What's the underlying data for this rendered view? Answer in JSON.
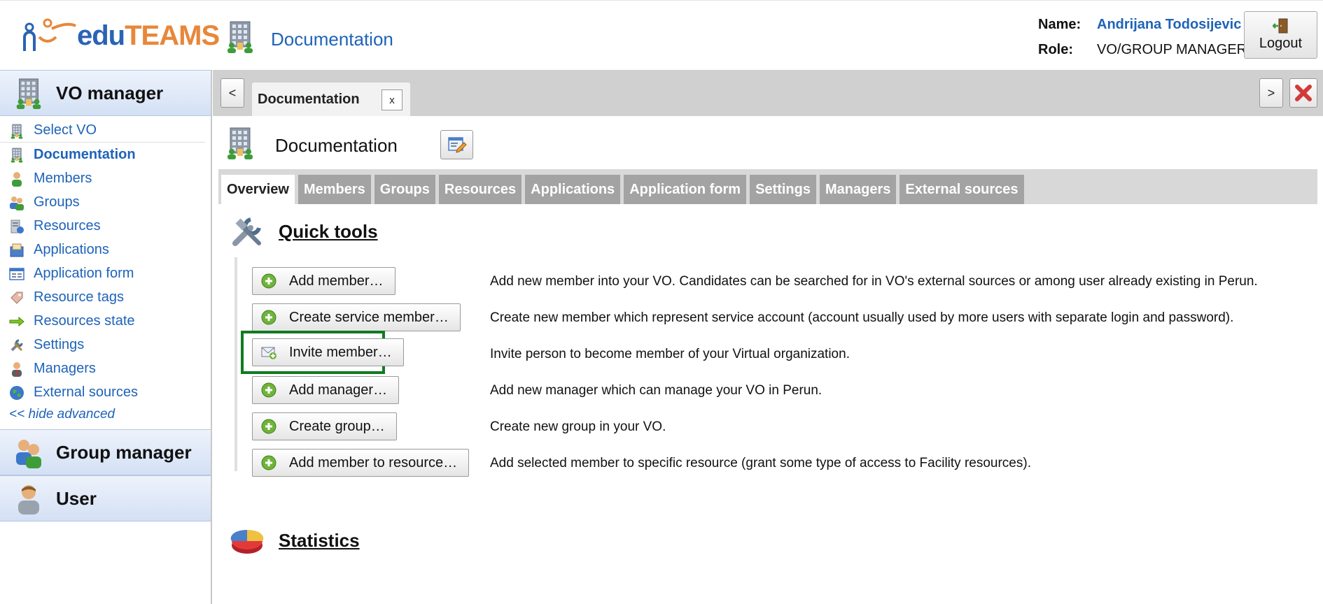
{
  "header": {
    "logo": {
      "part1": "edu",
      "part2": "TEAMS"
    },
    "section_title": "Documentation",
    "name_label": "Name:",
    "user_name": "Andrijana Todosijevic",
    "role_label": "Role:",
    "role_value": "VO/GROUP MANAGER",
    "logout_label": "Logout"
  },
  "sidebar": {
    "vo_manager_label": "VO manager",
    "items": [
      {
        "label": "Select VO",
        "icon": "building-icon"
      },
      {
        "label": "Documentation",
        "icon": "building-icon"
      },
      {
        "label": "Members",
        "icon": "person-icon"
      },
      {
        "label": "Groups",
        "icon": "group-icon"
      },
      {
        "label": "Resources",
        "icon": "resources-icon"
      },
      {
        "label": "Applications",
        "icon": "applications-icon"
      },
      {
        "label": "Application form",
        "icon": "form-icon"
      },
      {
        "label": "Resource tags",
        "icon": "tag-icon"
      },
      {
        "label": "Resources state",
        "icon": "arrow-right-icon"
      },
      {
        "label": "Settings",
        "icon": "tools-icon"
      },
      {
        "label": "Managers",
        "icon": "manager-icon"
      },
      {
        "label": "External sources",
        "icon": "globe-icon"
      }
    ],
    "hide_advanced": "<< hide advanced",
    "group_manager_label": "Group manager",
    "user_label": "User"
  },
  "tabbar": {
    "prev": "<",
    "next": ">",
    "active_tab": "Documentation",
    "active_tab_close": "x"
  },
  "page": {
    "title": "Documentation",
    "subtabs": [
      "Overview",
      "Members",
      "Groups",
      "Resources",
      "Applications",
      "Application form",
      "Settings",
      "Managers",
      "External sources"
    ],
    "active_subtab": "Overview",
    "quick_tools_title": "Quick tools",
    "statistics_title": "Statistics",
    "tools": [
      {
        "label": "Add member…",
        "icon": "add-icon",
        "description": "Add new member into your VO. Candidates can be searched for in VO's external sources or among user already existing in Perun."
      },
      {
        "label": "Create service member…",
        "icon": "add-icon",
        "description": "Create new member which represent service account (account usually used by more users with separate login and password)."
      },
      {
        "label": "Invite member…",
        "icon": "mail-icon",
        "description": "Invite person to become member of your Virtual organization."
      },
      {
        "label": "Add manager…",
        "icon": "add-icon",
        "description": "Add new manager which can manage your VO in Perun."
      },
      {
        "label": "Create group…",
        "icon": "add-icon",
        "description": "Create new group in your VO."
      },
      {
        "label": "Add member to resource…",
        "icon": "add-icon",
        "description": "Add selected member to specific resource (grant some type of access to Facility resources)."
      }
    ]
  },
  "colors": {
    "link_blue": "#1e63b8",
    "highlight_green": "#137a21",
    "panel_blue": "#d3e0f4"
  }
}
